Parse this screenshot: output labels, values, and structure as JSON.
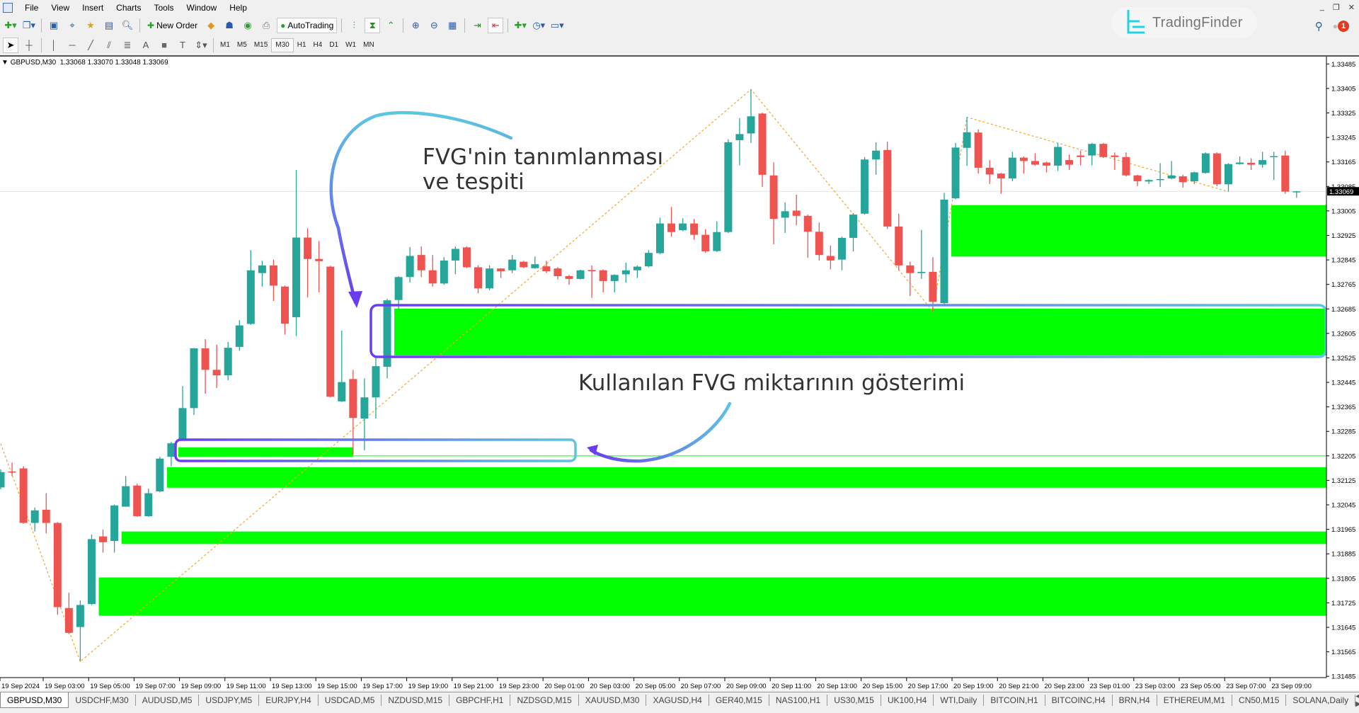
{
  "menu": [
    "File",
    "View",
    "Insert",
    "Charts",
    "Tools",
    "Window",
    "Help"
  ],
  "toolbar": {
    "new_order": "New Order",
    "auto_trading": "AutoTrading",
    "timeframes": [
      "M1",
      "M5",
      "M15",
      "M30",
      "H1",
      "H4",
      "D1",
      "W1",
      "MN"
    ],
    "active_timeframe": "M30"
  },
  "brand": {
    "logo_text": "TradingFinder",
    "logo_color": "#22d3e6"
  },
  "notifications": {
    "count": "1"
  },
  "chart_header": {
    "symbol": "GBPUSD,M30",
    "ohlc": "1.33068 1.33070 1.33048 1.33069"
  },
  "annotations": {
    "identify_line1": "FVG'nin tanımlanması",
    "identify_line2": "ve tespiti",
    "used_amount": "Kullanılan FVG miktarının gösterimi"
  },
  "chart_data": {
    "type": "candlestick",
    "symbol": "GBPUSD",
    "timeframe": "M30",
    "ylim": [
      1.31485,
      1.33485
    ],
    "y_ticks": [
      "1.33485",
      "1.33405",
      "1.33325",
      "1.33245",
      "1.33165",
      "1.33085",
      "1.33005",
      "1.32925",
      "1.32845",
      "1.32765",
      "1.32685",
      "1.32605",
      "1.32525",
      "1.32445",
      "1.32365",
      "1.32285",
      "1.32205",
      "1.32125",
      "1.32045",
      "1.31965",
      "1.31885",
      "1.31805",
      "1.31725",
      "1.31645",
      "1.31565",
      "1.31485"
    ],
    "current_price": "1.33069",
    "x_ticks": [
      "19 Sep 2024",
      "19 Sep 03:00",
      "19 Sep 05:00",
      "19 Sep 07:00",
      "19 Sep 09:00",
      "19 Sep 11:00",
      "19 Sep 13:00",
      "19 Sep 15:00",
      "19 Sep 17:00",
      "19 Sep 19:00",
      "19 Sep 21:00",
      "19 Sep 23:00",
      "20 Sep 01:00",
      "20 Sep 03:00",
      "20 Sep 05:00",
      "20 Sep 07:00",
      "20 Sep 09:00",
      "20 Sep 11:00",
      "20 Sep 13:00",
      "20 Sep 15:00",
      "20 Sep 17:00",
      "20 Sep 19:00",
      "20 Sep 21:00",
      "20 Sep 23:00",
      "23 Sep 01:00",
      "23 Sep 03:00",
      "23 Sep 05:00",
      "23 Sep 07:00",
      "23 Sep 09:00"
    ],
    "colors": {
      "bull": "#26a69a",
      "bear": "#ef5350",
      "fvg": "#00ff00",
      "zigzag": "#f5a623"
    },
    "ohlc": [
      [
        1.32102,
        1.32161,
        1.32096,
        1.32152
      ],
      [
        1.32154,
        1.32183,
        1.32139,
        1.32152
      ],
      [
        1.32164,
        1.32171,
        1.31983,
        1.31986
      ],
      [
        1.31986,
        1.32036,
        1.31958,
        1.32027
      ],
      [
        1.32029,
        1.32083,
        1.31952,
        1.31986
      ],
      [
        1.31986,
        1.31989,
        1.31686,
        1.31711
      ],
      [
        1.31708,
        1.31758,
        1.31623,
        1.31627
      ],
      [
        1.31646,
        1.31733,
        1.31533,
        1.31718
      ],
      [
        1.31721,
        1.31948,
        1.31718,
        1.31933
      ],
      [
        1.31942,
        1.31964,
        1.31889,
        1.31923
      ],
      [
        1.31927,
        1.32046,
        1.31889,
        1.32043
      ],
      [
        1.32039,
        1.32139,
        1.32039,
        1.32106
      ],
      [
        1.32108,
        1.32114,
        1.32006,
        1.32008
      ],
      [
        1.32008,
        1.32098,
        1.32006,
        1.32083
      ],
      [
        1.32089,
        1.32202,
        1.32086,
        1.32196
      ],
      [
        1.32202,
        1.32251,
        1.32171,
        1.32246
      ],
      [
        1.32258,
        1.32433,
        1.32256,
        1.32361
      ],
      [
        1.32361,
        1.32558,
        1.32339,
        1.32556
      ],
      [
        1.32556,
        1.32586,
        1.32408,
        1.32486
      ],
      [
        1.32486,
        1.32568,
        1.32427,
        1.32468
      ],
      [
        1.32468,
        1.32577,
        1.32452,
        1.32558
      ],
      [
        1.32561,
        1.32648,
        1.32548,
        1.32631
      ],
      [
        1.32636,
        1.32877,
        1.32633,
        1.32811
      ],
      [
        1.32802,
        1.32842,
        1.32758,
        1.32827
      ],
      [
        1.32827,
        1.32846,
        1.32711,
        1.32761
      ],
      [
        1.32758,
        1.32761,
        1.32601,
        1.32637
      ],
      [
        1.32658,
        1.33139,
        1.32596,
        1.32918
      ],
      [
        1.32918,
        1.32948,
        1.32723,
        1.32848
      ],
      [
        1.32848,
        1.32906,
        1.32739,
        1.32841
      ],
      [
        1.32823,
        1.32826,
        1.32396,
        1.32398
      ],
      [
        1.32383,
        1.32614,
        1.32381,
        1.32446
      ],
      [
        1.32456,
        1.32486,
        1.32208,
        1.32329
      ],
      [
        1.32327,
        1.32458,
        1.32223,
        1.32396
      ],
      [
        1.32396,
        1.32533,
        1.32327,
        1.32498
      ],
      [
        1.32496,
        1.32718,
        1.32458,
        1.32713
      ],
      [
        1.32714,
        1.32792,
        1.32683,
        1.32789
      ],
      [
        1.32789,
        1.32887,
        1.32771,
        1.32858
      ],
      [
        1.32861,
        1.32889,
        1.32789,
        1.32811
      ],
      [
        1.32811,
        1.32861,
        1.32758,
        1.32768
      ],
      [
        1.32768,
        1.32854,
        1.32764,
        1.32843
      ],
      [
        1.32843,
        1.32889,
        1.32798,
        1.32881
      ],
      [
        1.32886,
        1.32889,
        1.32818,
        1.32821
      ],
      [
        1.32821,
        1.32827,
        1.32736,
        1.32752
      ],
      [
        1.32752,
        1.32827,
        1.32746,
        1.32817
      ],
      [
        1.32817,
        1.32818,
        1.32786,
        1.32808
      ],
      [
        1.32811,
        1.32861,
        1.32802,
        1.32846
      ],
      [
        1.32839,
        1.32842,
        1.32818,
        1.32821
      ],
      [
        1.32818,
        1.32856,
        1.32816,
        1.32831
      ],
      [
        1.32824,
        1.32842,
        1.32802,
        1.32808
      ],
      [
        1.32817,
        1.32821,
        1.32781,
        1.32792
      ],
      [
        1.32792,
        1.32796,
        1.32764,
        1.32783
      ],
      [
        1.32783,
        1.32813,
        1.32781,
        1.32811
      ],
      [
        1.32812,
        1.32827,
        1.32721,
        1.32808
      ],
      [
        1.32811,
        1.32814,
        1.32739,
        1.32776
      ],
      [
        1.32776,
        1.32798,
        1.32739,
        1.32796
      ],
      [
        1.32798,
        1.32836,
        1.32771,
        1.32811
      ],
      [
        1.32811,
        1.32827,
        1.32786,
        1.32823
      ],
      [
        1.32824,
        1.32877,
        1.32821,
        1.32868
      ],
      [
        1.32867,
        1.32983,
        1.32864,
        1.32964
      ],
      [
        1.32964,
        1.33018,
        1.32921,
        1.32936
      ],
      [
        1.32942,
        1.32981,
        1.32939,
        1.32964
      ],
      [
        1.32964,
        1.32979,
        1.32911,
        1.32927
      ],
      [
        1.32927,
        1.32946,
        1.32868,
        1.32873
      ],
      [
        1.32874,
        1.32971,
        1.32871,
        1.32936
      ],
      [
        1.32936,
        1.33239,
        1.32933,
        1.33229
      ],
      [
        1.33236,
        1.33308,
        1.33154,
        1.33256
      ],
      [
        1.33258,
        1.33402,
        1.33227,
        1.33314
      ],
      [
        1.33323,
        1.33326,
        1.33083,
        1.33123
      ],
      [
        1.33121,
        1.33164,
        1.32896,
        1.32979
      ],
      [
        1.32983,
        1.33033,
        1.32933,
        1.33004
      ],
      [
        1.33006,
        1.33058,
        1.32958,
        1.32989
      ],
      [
        1.32989,
        1.32993,
        1.32852,
        1.32937
      ],
      [
        1.32937,
        1.32967,
        1.32843,
        1.32861
      ],
      [
        1.32858,
        1.32892,
        1.32814,
        1.32843
      ],
      [
        1.32846,
        1.32921,
        1.32811,
        1.32917
      ],
      [
        1.32917,
        1.32998,
        1.32873,
        1.32993
      ],
      [
        1.32996,
        1.33181,
        1.32993,
        1.33173
      ],
      [
        1.33173,
        1.33229,
        1.33123,
        1.33202
      ],
      [
        1.33204,
        1.33231,
        1.32946,
        1.32954
      ],
      [
        1.32954,
        1.32996,
        1.32811,
        1.32827
      ],
      [
        1.32827,
        1.32839,
        1.32727,
        1.32802
      ],
      [
        1.32802,
        1.32943,
        1.32783,
        1.32806
      ],
      [
        1.32806,
        1.32854,
        1.32677,
        1.32708
      ],
      [
        1.32704,
        1.33064,
        1.32696,
        1.33042
      ],
      [
        1.33046,
        1.33227,
        1.33043,
        1.33212
      ],
      [
        1.33211,
        1.33311,
        1.33152,
        1.33262
      ],
      [
        1.33261,
        1.33271,
        1.33127,
        1.33146
      ],
      [
        1.33146,
        1.33171,
        1.33093,
        1.33124
      ],
      [
        1.33127,
        1.33129,
        1.33061,
        1.33111
      ],
      [
        1.33111,
        1.33198,
        1.33102,
        1.33179
      ],
      [
        1.33179,
        1.33183,
        1.33127,
        1.33168
      ],
      [
        1.33168,
        1.33193,
        1.33153,
        1.33156
      ],
      [
        1.33163,
        1.33166,
        1.33131,
        1.33153
      ],
      [
        1.33153,
        1.33227,
        1.33136,
        1.33214
      ],
      [
        1.33171,
        1.33189,
        1.33139,
        1.33156
      ],
      [
        1.33186,
        1.33202,
        1.33154,
        1.33181
      ],
      [
        1.33186,
        1.33227,
        1.33154,
        1.33224
      ],
      [
        1.33224,
        1.33227,
        1.33178,
        1.33181
      ],
      [
        1.33186,
        1.33196,
        1.33139,
        1.33181
      ],
      [
        1.33181,
        1.33196,
        1.33118,
        1.33121
      ],
      [
        1.33121,
        1.33123,
        1.33086,
        1.33102
      ],
      [
        1.33101,
        1.33108,
        1.33093,
        1.33106
      ],
      [
        1.33106,
        1.33161,
        1.33083,
        1.33109
      ],
      [
        1.33111,
        1.33168,
        1.33108,
        1.33121
      ],
      [
        1.33118,
        1.33123,
        1.33081,
        1.33099
      ],
      [
        1.33102,
        1.33133,
        1.33093,
        1.33131
      ],
      [
        1.33129,
        1.33196,
        1.33127,
        1.33193
      ],
      [
        1.33193,
        1.33196,
        1.33086,
        1.33092
      ],
      [
        1.33092,
        1.33161,
        1.33068,
        1.33158
      ],
      [
        1.33158,
        1.33183,
        1.33156,
        1.33163
      ],
      [
        1.33162,
        1.33177,
        1.33139,
        1.33156
      ],
      [
        1.33156,
        1.33198,
        1.33146,
        1.33171
      ],
      [
        1.33182,
        1.33198,
        1.33106,
        1.33184
      ],
      [
        1.33186,
        1.33202,
        1.33061,
        1.33068
      ],
      [
        1.33068,
        1.3307,
        1.33048,
        1.33069
      ]
    ],
    "fvg_zones": [
      {
        "start_index": 35,
        "top": 1.32686,
        "bottom": 1.32533
      },
      {
        "start_index": 84,
        "top": 1.33024,
        "bottom": 1.32856
      },
      {
        "start_index": 16,
        "end_index": 31,
        "top": 1.32233,
        "bottom": 1.32202,
        "used_level": 1.32205
      },
      {
        "start_index": 15,
        "top": 1.32168,
        "bottom": 1.32101
      },
      {
        "start_index": 11,
        "top": 1.31958,
        "bottom": 1.31917
      },
      {
        "start_index": 9,
        "top": 1.31808,
        "bottom": 1.31683
      }
    ],
    "zigzag": [
      [
        0,
        1.32245
      ],
      [
        7,
        1.31533
      ],
      [
        66,
        1.33402
      ],
      [
        82,
        1.32677
      ],
      [
        85,
        1.33311
      ],
      [
        108,
        1.33068
      ]
    ]
  },
  "tabs": [
    "GBPUSD,M30",
    "USDCHF,M30",
    "AUDUSD,M5",
    "USDJPY,M5",
    "EURJPY,H4",
    "USDCAD,M5",
    "NZDUSD,M15",
    "GBPCHF,H1",
    "NZDSGD,M15",
    "XAUUSD,M30",
    "XAGUSD,H4",
    "GER40,M15",
    "NAS100,H1",
    "US30,M15",
    "UK100,H4",
    "WTI,Daily",
    "BITCOIN,H1",
    "BITCOINC,H4",
    "BRN,H4",
    "ETHEREUM,M1",
    "CN50,M15",
    "SOLANA,Daily"
  ],
  "active_tab": "GBPUSD,M30"
}
